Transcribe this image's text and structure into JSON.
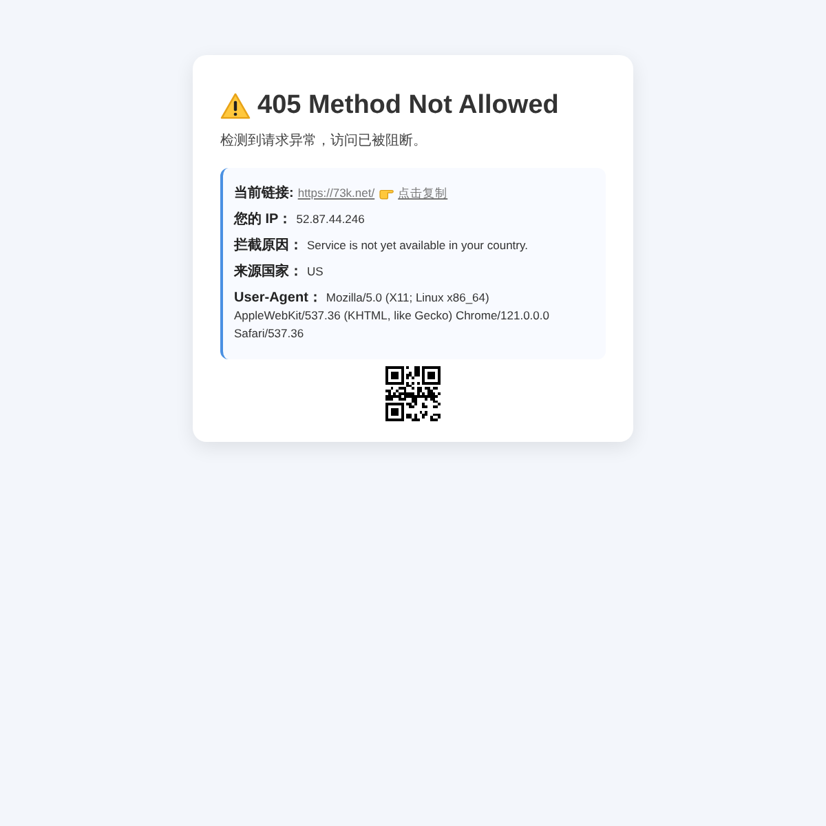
{
  "card": {
    "title": "405 Method Not Allowed",
    "subtitle": "检测到请求异常，访问已被阻断。"
  },
  "details": [
    {
      "kind": "link",
      "label": "当前链接:",
      "url": "https://73k.net/",
      "action": "点击复制"
    },
    {
      "kind": "text",
      "label": "您的 IP：",
      "value": "52.87.44.246"
    },
    {
      "kind": "text",
      "label": "拦截原因：",
      "value": "Service is not yet available in your country."
    },
    {
      "kind": "text",
      "label": "来源国家：",
      "value": "US"
    },
    {
      "kind": "text",
      "label": "User-Agent：",
      "value": "Mozilla/5.0 (X11; Linux x86_64) AppleWebKit/537.36 (KHTML, like Gecko) Chrome/121.0.0.0 Safari/537.36"
    }
  ]
}
